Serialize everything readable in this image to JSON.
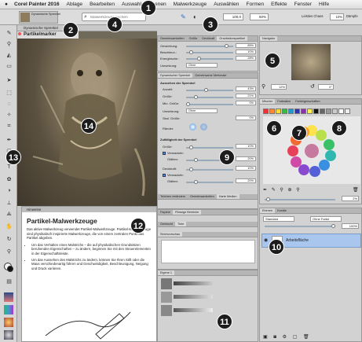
{
  "menubar": {
    "apple": "",
    "items": [
      "Corel Painter 2016",
      "Ablage",
      "Bearbeiten",
      "Auswahl",
      "Ebenen",
      "Malwerkzeuge",
      "Auswählen",
      "Formen",
      "Effekte",
      "Fenster",
      "Hilfe"
    ]
  },
  "propbar": {
    "brush_category": "Dynamische Sprenkel",
    "brush_variant": "Partikelmarker",
    "search_placeholder": "Malwerkzeuge suchen",
    "size_value": "100,0",
    "opacity_value": "50%",
    "layer_label": "Leisties Chaos",
    "layer_value": "10%",
    "damp_label": "Dämpfe"
  },
  "canvas": {
    "tab_label": "Dynamische Sprenkel",
    "title": "Partikelmarker"
  },
  "brush_panel": {
    "tabs": [
      "Gemeinsamkeiten",
      "Größe",
      "Deckkraft",
      "Gravitationspartikel"
    ],
    "sliders": [
      {
        "label": "Gewichtung:",
        "value": "85%",
        "fill": 0.85
      },
      {
        "label": "Beschleun.:",
        "value": "10%",
        "fill": 0.1
      },
      {
        "label": "Energiesche.:",
        "value": "28%",
        "fill": 0.28
      }
    ],
    "umsetzung_label": "Umsetzung:",
    "umsetzung_value": "Ohne"
  },
  "sprenkel_panel": {
    "tabs": [
      "Dynamischer Sprenkel",
      "Gemeinsame Merkmale"
    ],
    "section_title": "Aussehen der Sprenkel",
    "rows": [
      {
        "label": "Anzahl:",
        "value": "43%",
        "fill": 0.43
      },
      {
        "label": "Größe:",
        "value": "21%",
        "fill": 0.21
      },
      {
        "label": "Min. Größe:",
        "value": "0%",
        "fill": 0.0
      }
    ],
    "ausgeben_label": "Umsetzung:",
    "ausgeben_value": "Ohne",
    "skal_label": "Skal. Größe:",
    "skal_value": "0%",
    "raender_label": "Ränder:",
    "section2_title": "Zufälligkeit der Sprenkel",
    "rows2": [
      {
        "label": "Größe:",
        "value": "10%",
        "fill": 0.1
      },
      {
        "label": "Verwackeln",
        "value": "",
        "fill": 0.0
      },
      {
        "label": "Glätten:",
        "value": "20%",
        "fill": 0.2
      },
      {
        "label": "Deckkraft:",
        "value": "10%",
        "fill": 0.1
      },
      {
        "label": "Verwackeln",
        "value": "",
        "fill": 0.0
      },
      {
        "label": "Glätten:",
        "value": "20%",
        "fill": 0.2
      }
    ],
    "bottom_tabs": [
      "Teilchen verändern",
      "Gemeinsamkeiten",
      "Harte Medien"
    ]
  },
  "navigator": {
    "tab_label": "Navigator",
    "zoom_value": "12%",
    "rotation_value": "0°"
  },
  "mixer": {
    "tabs": [
      "Mischer",
      "Farbsätze",
      "Farbeigenschaften"
    ],
    "size_value": "2%"
  },
  "layers": {
    "tabs": [
      "Ebenen",
      "Kanäle"
    ],
    "composite_value": "Standard",
    "preserve_label": "Ohne Farbe",
    "opacity_value": "100%",
    "layer_name": "Arbeitsfläche"
  },
  "texture_panel": {
    "tabs": [
      "Papiere",
      "Flüssige Bereiche",
      "Gemischt",
      "Tinte"
    ],
    "sub_tab": "Strichvorschau"
  },
  "brushes_panel": {
    "tab_label": "Eigene 1"
  },
  "hints": {
    "tab_label": "Hinweise",
    "title": "Partikel-Malwerkzeuge",
    "intro": "Das aktive Malwerkzeug verwendet Partikel-Malwerkzeuge. Partikel-Malwerkzeuge sind physikalisch inspirierte Malwerkzeuge, die von einem zentralen Punkt aus Partikel abgeben.",
    "bullets": [
      "Um das Verhalten eines Malstrichs – die auf physikalischen Grundsätzen beruhenden Eigenschaften – zu ändern, beginnen Sie mit den Steuerelementen in der Eigenschaftsleiste.",
      "Um das Aussehen des Malstrichs zu ändern, können Sie Ihren Stift oder die Maus verschiedenartig führen und Geschwindigkeit, Beschleunigung, Neigung und Druck variieren."
    ]
  },
  "callouts": [
    "1",
    "2",
    "3",
    "4",
    "5",
    "6",
    "7",
    "8",
    "9",
    "10",
    "11",
    "12",
    "13",
    "14"
  ],
  "colors": {
    "badge": "#1c1c1c",
    "panel": "#d2d2d2",
    "slider": "#99aabb",
    "accent_blue": "#4a8fe0"
  }
}
